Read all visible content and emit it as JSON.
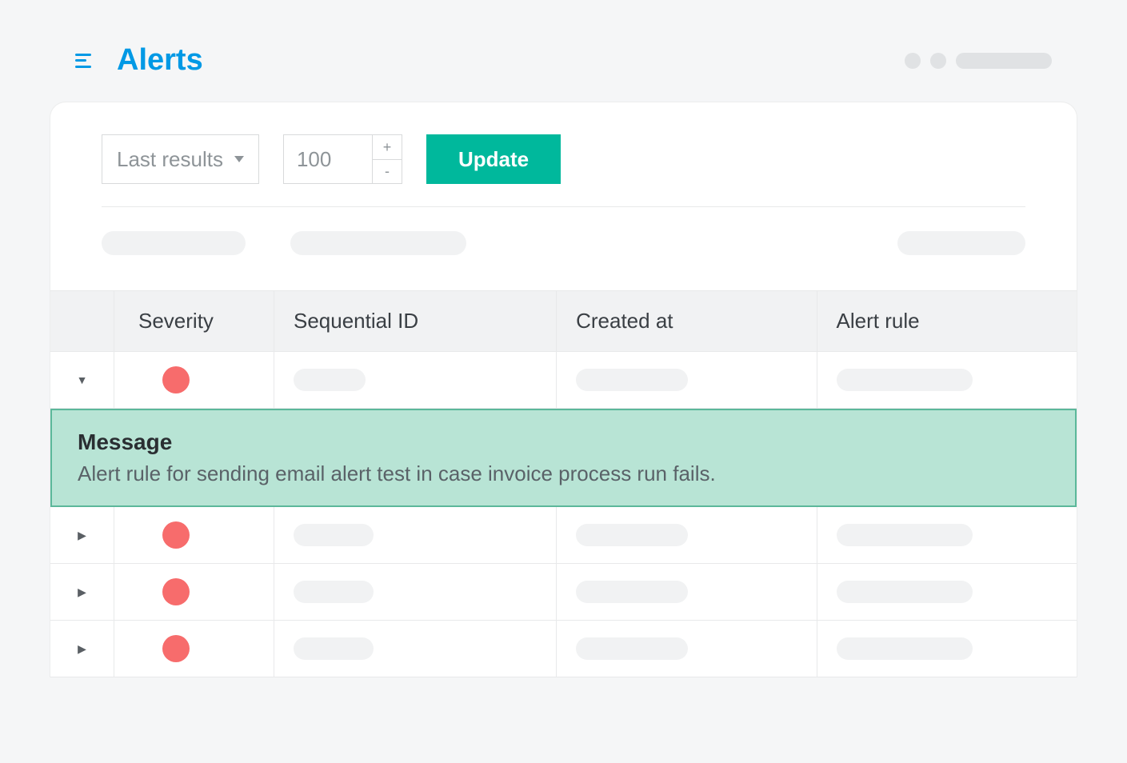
{
  "header": {
    "title": "Alerts"
  },
  "controls": {
    "filter_select": "Last results",
    "count_value": "100",
    "update_label": "Update"
  },
  "table": {
    "columns": {
      "severity": "Severity",
      "sequential_id": "Sequential ID",
      "created_at": "Created at",
      "alert_rule": "Alert rule"
    },
    "rows": [
      {
        "expanded": true,
        "severity_color": "#f76c6c"
      },
      {
        "expanded": false,
        "severity_color": "#f76c6c"
      },
      {
        "expanded": false,
        "severity_color": "#f76c6c"
      },
      {
        "expanded": false,
        "severity_color": "#f76c6c"
      }
    ],
    "detail": {
      "label": "Message",
      "text": "Alert rule for sending email alert test in case invoice process run fails."
    }
  }
}
